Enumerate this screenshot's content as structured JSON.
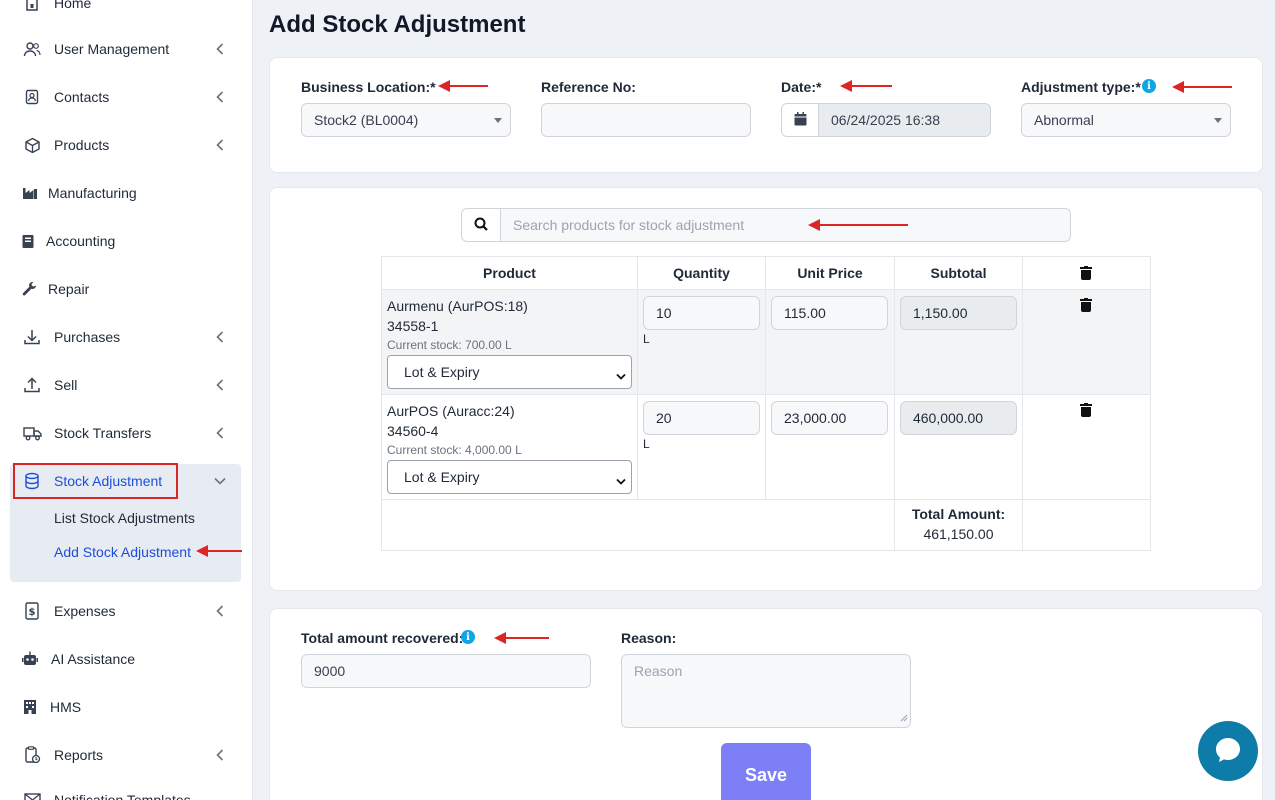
{
  "sidebar": {
    "items": [
      {
        "label": "Home",
        "icon": "home-icon"
      },
      {
        "label": "User Management",
        "icon": "users-icon"
      },
      {
        "label": "Contacts",
        "icon": "contacts-icon"
      },
      {
        "label": "Products",
        "icon": "cube-icon"
      },
      {
        "label": "Manufacturing",
        "icon": "industry-icon"
      },
      {
        "label": "Accounting",
        "icon": "book-icon"
      },
      {
        "label": "Repair",
        "icon": "wrench-icon"
      },
      {
        "label": "Purchases",
        "icon": "download-icon"
      },
      {
        "label": "Sell",
        "icon": "upload-icon"
      },
      {
        "label": "Stock Transfers",
        "icon": "truck-icon"
      },
      {
        "label": "Stock Adjustment",
        "icon": "database-icon"
      },
      {
        "label": "Expenses",
        "icon": "dollar-file-icon"
      },
      {
        "label": "AI Assistance",
        "icon": "robot-icon"
      },
      {
        "label": "HMS",
        "icon": "hotel-icon"
      },
      {
        "label": "Reports",
        "icon": "report-icon"
      },
      {
        "label": "Notification Templates",
        "icon": "envelope-icon"
      }
    ],
    "sub_items": [
      {
        "label": "List Stock Adjustments"
      },
      {
        "label": "Add Stock Adjustment"
      }
    ]
  },
  "page": {
    "title": "Add Stock Adjustment"
  },
  "form": {
    "business_location": {
      "label": "Business Location:*",
      "value": "Stock2 (BL0004)"
    },
    "reference_no": {
      "label": "Reference No:",
      "value": ""
    },
    "date": {
      "label": "Date:*",
      "value": "06/24/2025 16:38"
    },
    "adjustment_type": {
      "label": "Adjustment type:*",
      "value": "Abnormal"
    }
  },
  "search": {
    "placeholder": "Search products for stock adjustment"
  },
  "table": {
    "headers": [
      "Product",
      "Quantity",
      "Unit Price",
      "Subtotal"
    ],
    "rows": [
      {
        "name": "Aurmenu (AurPOS:18)",
        "sku": "34558-1",
        "stock": "Current stock: 700.00 L",
        "lot": "Lot & Expiry",
        "quantity": "10",
        "unit": "L",
        "unit_price": "115.00",
        "subtotal": "1,150.00"
      },
      {
        "name": "AurPOS (Auracc:24)",
        "sku": "34560-4",
        "stock": "Current stock: 4,000.00 L",
        "lot": "Lot & Expiry",
        "quantity": "20",
        "unit": "L",
        "unit_price": "23,000.00",
        "subtotal": "460,000.00"
      }
    ],
    "total_label": "Total Amount:",
    "total_value": "461,150.00"
  },
  "recovery": {
    "label": "Total amount recovered:",
    "value": "9000",
    "reason_label": "Reason:",
    "reason_placeholder": "Reason"
  },
  "actions": {
    "save_label": "Save"
  },
  "colors": {
    "accent": "#1d4ed8",
    "annotation_red": "#dc2626",
    "save_button": "#7c7ff5",
    "chat_button": "#0e7ca8"
  }
}
